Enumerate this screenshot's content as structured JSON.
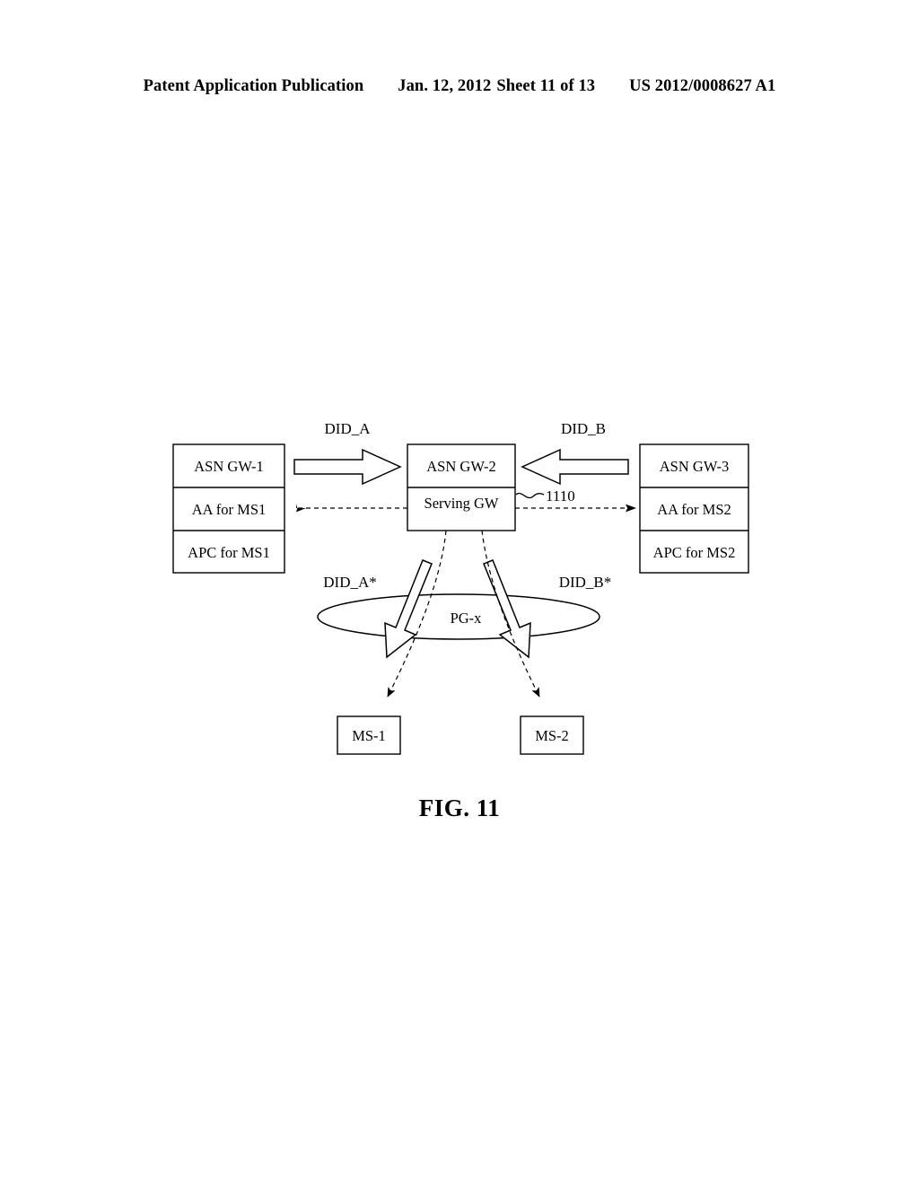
{
  "header": {
    "publication": "Patent Application Publication",
    "date": "Jan. 12, 2012",
    "sheet": "Sheet 11 of 13",
    "patent_number": "US 2012/0008627 A1"
  },
  "figure": {
    "caption": "FIG. 11"
  },
  "diagram": {
    "left_node": {
      "rows": [
        "ASN GW-1",
        "AA for MS1",
        "APC for MS1"
      ]
    },
    "center_node": {
      "rows": [
        "ASN GW-2",
        "Serving GW"
      ]
    },
    "right_node": {
      "rows": [
        "ASN GW-3",
        "AA for MS2",
        "APC for MS2"
      ]
    },
    "paging_group": {
      "label": "PG-x"
    },
    "mobile_stations": [
      "MS-1",
      "MS-2"
    ],
    "flow_labels": {
      "did_a": "DID_A",
      "did_b": "DID_B",
      "did_a_star": "DID_A*",
      "did_b_star": "DID_B*"
    },
    "reference_numeral": "1110"
  }
}
